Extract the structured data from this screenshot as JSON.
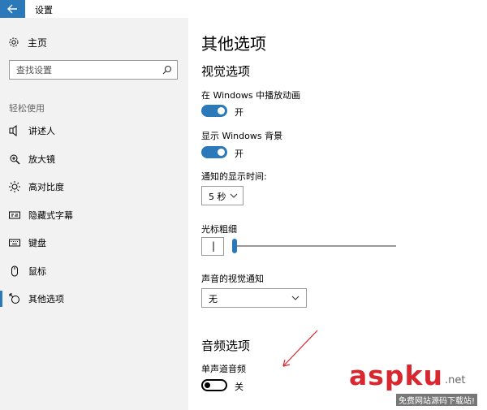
{
  "window": {
    "title": "设置"
  },
  "sidebar": {
    "home_label": "主页",
    "search_placeholder": "查找设置",
    "section_label": "轻松使用",
    "items": [
      {
        "label": "讲述人",
        "icon": "narrator-icon"
      },
      {
        "label": "放大镜",
        "icon": "magnifier-icon"
      },
      {
        "label": "高对比度",
        "icon": "high-contrast-icon"
      },
      {
        "label": "隐藏式字幕",
        "icon": "closed-captions-icon"
      },
      {
        "label": "键盘",
        "icon": "keyboard-icon"
      },
      {
        "label": "鼠标",
        "icon": "mouse-icon"
      },
      {
        "label": "其他选项",
        "icon": "other-options-icon",
        "selected": true
      }
    ]
  },
  "main": {
    "page_title": "其他选项",
    "visual": {
      "heading": "视觉选项",
      "animations": {
        "label": "在 Windows 中播放动画",
        "state": "开",
        "on": true
      },
      "background": {
        "label": "显示 Windows 背景",
        "state": "开",
        "on": true
      },
      "notification": {
        "label": "通知的显示时间:",
        "value": "5 秒"
      },
      "cursor": {
        "label": "光标粗细",
        "value": "|",
        "level": 1
      },
      "sound_visual": {
        "label": "声音的视觉通知",
        "value": "无"
      }
    },
    "audio": {
      "heading": "音频选项",
      "mono": {
        "label": "单声道音频",
        "state": "关",
        "on": false
      }
    }
  },
  "watermark": {
    "brand": "aspku",
    "suffix": ".net",
    "subtitle": "免费网站源码下载站!"
  },
  "colors": {
    "accent": "#2b79b9",
    "sidebar_bg": "#f2f2f2",
    "annotation": "#d8272f"
  }
}
